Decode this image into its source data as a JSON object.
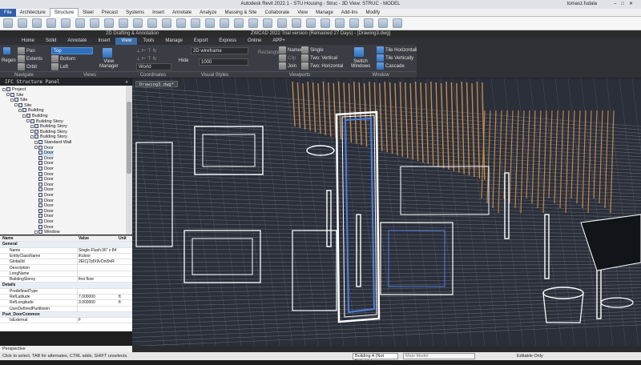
{
  "revit": {
    "title": "Autodesk Revit 2022.1 - STU Housing - Struc - 3D View: STRUC - MODEL",
    "user": "tomasz.fudala",
    "tabs": [
      "File",
      "Architecture",
      "Structure",
      "Steel",
      "Precast",
      "Systems",
      "Insert",
      "Annotate",
      "Analyze",
      "Massing & Site",
      "Collaborate",
      "View",
      "Manage",
      "Add-Ins",
      "Modify"
    ],
    "active_tab": "Structure",
    "status_message": "Click to select, TAB for alternates, CTRL adds, SHIFT unselects.",
    "workset": "Building A (Not Editable)",
    "design_option": "Main Model",
    "editable_only": "Editable Only",
    "view_name": "Perspective"
  },
  "zwcad": {
    "workspace": "2D Drafting & Annotation",
    "title": "ZWCAD 2022 Trial version (Remained 27 Days) - [Drawing3.dwg]",
    "menu": [
      "Home",
      "Solid",
      "Annotate",
      "Insert",
      "View",
      "Tools",
      "Manage",
      "Export",
      "Express",
      "Online",
      "APP+"
    ],
    "active_menu": "View",
    "navigate": {
      "pan": "Pan",
      "extents": "Extents",
      "orbit": "Orbit",
      "regen": "Regen"
    },
    "views": {
      "top": "Top",
      "bottom": "Bottom",
      "left": "Left",
      "view_manager": "View\nManager"
    },
    "coordinates": {
      "world": "World"
    },
    "visual_styles": {
      "style": "2D wireframe",
      "hide": "Hide",
      "value": "1000"
    },
    "viewports": {
      "named": "Named",
      "single": "Single",
      "two_vertical": "Two: Vertical",
      "join": "Join",
      "two_horizontal": "Two: Horizontal",
      "clip": "Clip",
      "rectangle": "Rectangle"
    },
    "window": {
      "switch": "Switch Windows",
      "tile_h": "Tile Horizontally",
      "tile_v": "Tile Vertically",
      "cascade": "Cascade"
    },
    "panels": [
      "Navigate",
      "Views",
      "Coordinates",
      "Visual Styles",
      "Viewports",
      "Window"
    ],
    "drawing_tab": "Drawing3.dwg*"
  },
  "ifc_panel": {
    "title": "IFC Structure Panel",
    "tree": [
      {
        "label": "Project",
        "depth": 0
      },
      {
        "label": "Site",
        "depth": 1
      },
      {
        "label": "Site",
        "depth": 2
      },
      {
        "label": "Site",
        "depth": 3
      },
      {
        "label": "Building",
        "depth": 4
      },
      {
        "label": "Building",
        "depth": 5
      },
      {
        "label": "Building Story",
        "depth": 6
      },
      {
        "label": "Building Story",
        "depth": 7
      },
      {
        "label": "Building Story",
        "depth": 7
      },
      {
        "label": "Building Story",
        "depth": 7
      },
      {
        "label": "Standard Wall",
        "depth": 8
      },
      {
        "label": "Door",
        "depth": 8
      },
      {
        "label": "Door",
        "depth": 9,
        "selected": true
      },
      {
        "label": "Door",
        "depth": 9
      },
      {
        "label": "Door",
        "depth": 9
      },
      {
        "label": "Door",
        "depth": 9
      },
      {
        "label": "Door",
        "depth": 9
      },
      {
        "label": "Door",
        "depth": 9
      },
      {
        "label": "Door",
        "depth": 9
      },
      {
        "label": "Door",
        "depth": 9
      },
      {
        "label": "Door",
        "depth": 9
      },
      {
        "label": "Door",
        "depth": 9
      },
      {
        "label": "Door",
        "depth": 9
      },
      {
        "label": "Door",
        "depth": 9
      },
      {
        "label": "Door",
        "depth": 9
      },
      {
        "label": "Door",
        "depth": 9
      },
      {
        "label": "Door",
        "depth": 9
      },
      {
        "label": "Window",
        "depth": 8
      }
    ]
  },
  "properties": {
    "headers": [
      "Name",
      "Value",
      "Unit"
    ],
    "rows": [
      {
        "type": "group",
        "name": "General"
      },
      {
        "name": "Name",
        "value": "Single-Flush:36\" x 84",
        "unit": ""
      },
      {
        "name": "EntityClassName",
        "value": "ifcdoor",
        "unit": ""
      },
      {
        "name": "GlobalId",
        "value": "2EICj7pfX9vOnt9vR",
        "unit": ""
      },
      {
        "name": "Description",
        "value": "",
        "unit": ""
      },
      {
        "name": "LongName",
        "value": "",
        "unit": ""
      },
      {
        "name": "BuildingStorey",
        "value": "first floor",
        "unit": ""
      },
      {
        "type": "group",
        "name": "Details"
      },
      {
        "name": "PredefinedType",
        "value": "",
        "unit": ""
      },
      {
        "name": "RefLatitude",
        "value": "7.000000",
        "unit": "ft"
      },
      {
        "name": "RefLongitude",
        "value": "3.000000",
        "unit": "ft"
      },
      {
        "name": "UserDefinedPartitioningType",
        "value": "",
        "unit": ""
      },
      {
        "type": "group",
        "name": "Pset_DoorCommon"
      },
      {
        "name": "IsExternal",
        "value": "F",
        "unit": ""
      }
    ]
  },
  "colors": {
    "revit_blue": "#2f5fa8",
    "zw_dark": "#2f3136",
    "wire": "#ffffff",
    "wood": "#d9954a",
    "selection": "#4f7fe0",
    "viewport_bg": "#2a2f3a"
  }
}
